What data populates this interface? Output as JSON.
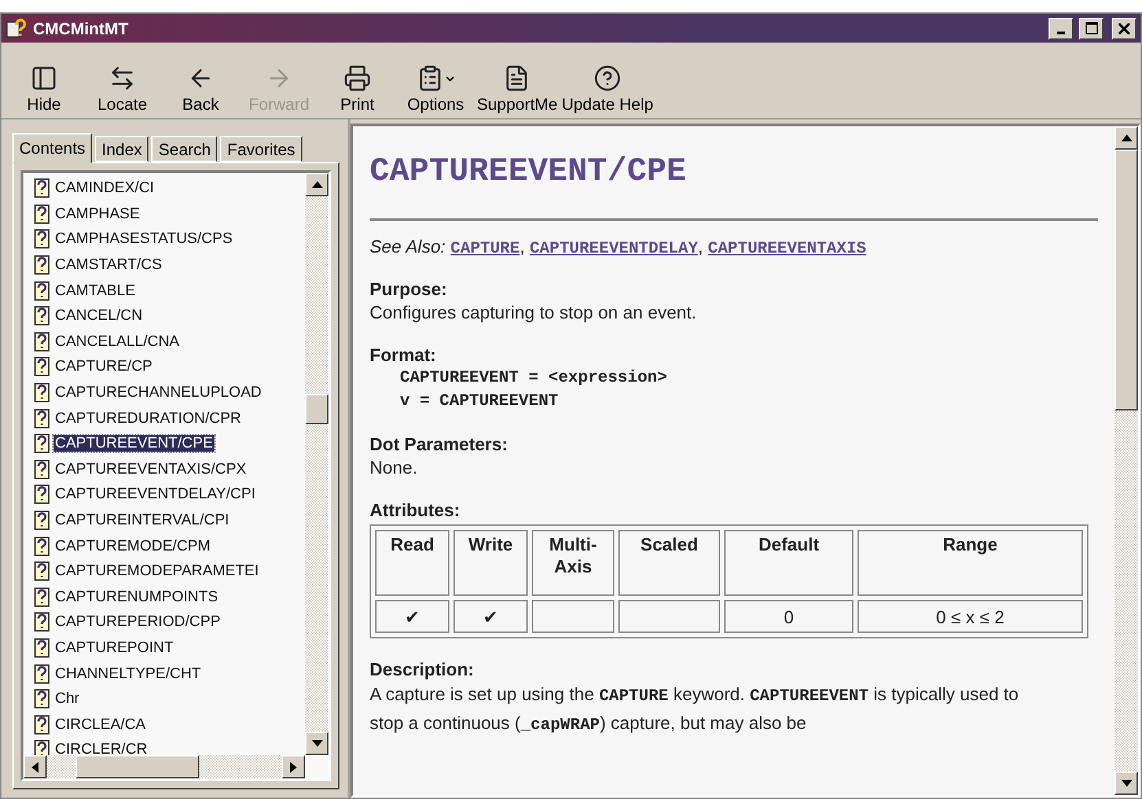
{
  "window": {
    "title": "CMCMintMT"
  },
  "toolbar": [
    {
      "kind": "hide",
      "label": "Hide",
      "disabled": false
    },
    {
      "kind": "locate",
      "label": "Locate",
      "disabled": false
    },
    {
      "kind": "back",
      "label": "Back",
      "disabled": false
    },
    {
      "kind": "forward",
      "label": "Forward",
      "disabled": true
    },
    {
      "kind": "print",
      "label": "Print",
      "disabled": false
    },
    {
      "kind": "options",
      "label": "Options",
      "disabled": false
    },
    {
      "kind": "support",
      "label": "SupportMe",
      "disabled": false
    },
    {
      "kind": "update",
      "label": "Update Help",
      "disabled": false
    }
  ],
  "tabs": [
    {
      "label": "Contents",
      "selected": true
    },
    {
      "label": "Index",
      "selected": false
    },
    {
      "label": "Search",
      "selected": false
    },
    {
      "label": "Favorites",
      "selected": false
    }
  ],
  "tree": [
    {
      "label": "CAMINDEX/CI",
      "selected": false
    },
    {
      "label": "CAMPHASE",
      "selected": false
    },
    {
      "label": "CAMPHASESTATUS/CPS",
      "selected": false
    },
    {
      "label": "CAMSTART/CS",
      "selected": false
    },
    {
      "label": "CAMTABLE",
      "selected": false
    },
    {
      "label": "CANCEL/CN",
      "selected": false
    },
    {
      "label": "CANCELALL/CNA",
      "selected": false
    },
    {
      "label": "CAPTURE/CP",
      "selected": false
    },
    {
      "label": "CAPTURECHANNELUPLOAD",
      "selected": false
    },
    {
      "label": "CAPTUREDURATION/CPR",
      "selected": false
    },
    {
      "label": "CAPTUREEVENT/CPE",
      "selected": true
    },
    {
      "label": "CAPTUREEVENTAXIS/CPX",
      "selected": false
    },
    {
      "label": "CAPTUREEVENTDELAY/CPI",
      "selected": false
    },
    {
      "label": "CAPTUREINTERVAL/CPI",
      "selected": false
    },
    {
      "label": "CAPTUREMODE/CPM",
      "selected": false
    },
    {
      "label": "CAPTUREMODEPARAMETEI",
      "selected": false
    },
    {
      "label": "CAPTURENUMPOINTS",
      "selected": false
    },
    {
      "label": "CAPTUREPERIOD/CPP",
      "selected": false
    },
    {
      "label": "CAPTUREPOINT",
      "selected": false
    },
    {
      "label": "CHANNELTYPE/CHT",
      "selected": false
    },
    {
      "label": "Chr",
      "selected": false
    },
    {
      "label": "CIRCLEA/CA",
      "selected": false
    },
    {
      "label": "CIRCLER/CR",
      "selected": false
    }
  ],
  "topic": {
    "title": "CAPTUREEVENT/CPE",
    "see_also_label": "See Also:",
    "see_also": [
      "CAPTURE",
      "CAPTUREEVENTDELAY",
      "CAPTUREEVENTAXIS"
    ],
    "see_also_separator": ",",
    "purpose_heading": "Purpose:",
    "purpose": "Configures capturing to stop on an event.",
    "format_heading": "Format:",
    "format_lines": [
      "CAPTUREEVENT = <expression>",
      "v = CAPTUREEVENT"
    ],
    "dot_heading": "Dot Parameters:",
    "dot_text": "None.",
    "attributes_heading": "Attributes:",
    "table": {
      "columns": [
        "Read",
        "Write",
        "Multi-Axis",
        "Scaled",
        "Default",
        "Range"
      ],
      "rows": [
        [
          "✔",
          "✔",
          "",
          "",
          "0",
          "0 ≤ x ≤ 2"
        ]
      ]
    },
    "description_heading": "Description:",
    "description": "A capture is set up using the **CAPTURE** keyword. **CAPTUREEVENT** is typically used to stop a continuous (**_capWRAP**) capture, but may also be"
  }
}
